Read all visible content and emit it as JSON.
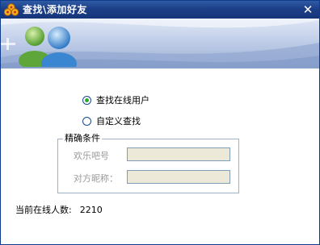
{
  "window": {
    "title": "查找\\添加好友",
    "close_glyph": "✕"
  },
  "options": {
    "online_label": "查找在线用户",
    "custom_label": "自定义查找",
    "selected": "online"
  },
  "criteria": {
    "legend": "精确条件",
    "id_label": "欢乐吧号",
    "nick_label": "对方昵称：",
    "id_value": "",
    "nick_value": ""
  },
  "status": {
    "label": "当前在线人数:",
    "value": "2210"
  },
  "colors": {
    "titlebar": "#1d3f88",
    "radio_dot": "#2eaa2e",
    "field_disabled": "#ece9d8"
  }
}
